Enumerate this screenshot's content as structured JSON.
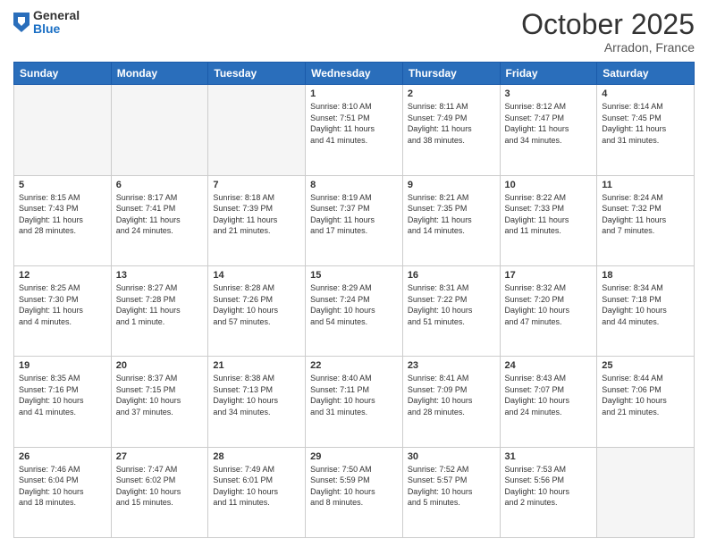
{
  "logo": {
    "general": "General",
    "blue": "Blue"
  },
  "header": {
    "month": "October 2025",
    "location": "Arradon, France"
  },
  "weekdays": [
    "Sunday",
    "Monday",
    "Tuesday",
    "Wednesday",
    "Thursday",
    "Friday",
    "Saturday"
  ],
  "weeks": [
    [
      {
        "day": "",
        "info": ""
      },
      {
        "day": "",
        "info": ""
      },
      {
        "day": "",
        "info": ""
      },
      {
        "day": "1",
        "info": "Sunrise: 8:10 AM\nSunset: 7:51 PM\nDaylight: 11 hours\nand 41 minutes."
      },
      {
        "day": "2",
        "info": "Sunrise: 8:11 AM\nSunset: 7:49 PM\nDaylight: 11 hours\nand 38 minutes."
      },
      {
        "day": "3",
        "info": "Sunrise: 8:12 AM\nSunset: 7:47 PM\nDaylight: 11 hours\nand 34 minutes."
      },
      {
        "day": "4",
        "info": "Sunrise: 8:14 AM\nSunset: 7:45 PM\nDaylight: 11 hours\nand 31 minutes."
      }
    ],
    [
      {
        "day": "5",
        "info": "Sunrise: 8:15 AM\nSunset: 7:43 PM\nDaylight: 11 hours\nand 28 minutes."
      },
      {
        "day": "6",
        "info": "Sunrise: 8:17 AM\nSunset: 7:41 PM\nDaylight: 11 hours\nand 24 minutes."
      },
      {
        "day": "7",
        "info": "Sunrise: 8:18 AM\nSunset: 7:39 PM\nDaylight: 11 hours\nand 21 minutes."
      },
      {
        "day": "8",
        "info": "Sunrise: 8:19 AM\nSunset: 7:37 PM\nDaylight: 11 hours\nand 17 minutes."
      },
      {
        "day": "9",
        "info": "Sunrise: 8:21 AM\nSunset: 7:35 PM\nDaylight: 11 hours\nand 14 minutes."
      },
      {
        "day": "10",
        "info": "Sunrise: 8:22 AM\nSunset: 7:33 PM\nDaylight: 11 hours\nand 11 minutes."
      },
      {
        "day": "11",
        "info": "Sunrise: 8:24 AM\nSunset: 7:32 PM\nDaylight: 11 hours\nand 7 minutes."
      }
    ],
    [
      {
        "day": "12",
        "info": "Sunrise: 8:25 AM\nSunset: 7:30 PM\nDaylight: 11 hours\nand 4 minutes."
      },
      {
        "day": "13",
        "info": "Sunrise: 8:27 AM\nSunset: 7:28 PM\nDaylight: 11 hours\nand 1 minute."
      },
      {
        "day": "14",
        "info": "Sunrise: 8:28 AM\nSunset: 7:26 PM\nDaylight: 10 hours\nand 57 minutes."
      },
      {
        "day": "15",
        "info": "Sunrise: 8:29 AM\nSunset: 7:24 PM\nDaylight: 10 hours\nand 54 minutes."
      },
      {
        "day": "16",
        "info": "Sunrise: 8:31 AM\nSunset: 7:22 PM\nDaylight: 10 hours\nand 51 minutes."
      },
      {
        "day": "17",
        "info": "Sunrise: 8:32 AM\nSunset: 7:20 PM\nDaylight: 10 hours\nand 47 minutes."
      },
      {
        "day": "18",
        "info": "Sunrise: 8:34 AM\nSunset: 7:18 PM\nDaylight: 10 hours\nand 44 minutes."
      }
    ],
    [
      {
        "day": "19",
        "info": "Sunrise: 8:35 AM\nSunset: 7:16 PM\nDaylight: 10 hours\nand 41 minutes."
      },
      {
        "day": "20",
        "info": "Sunrise: 8:37 AM\nSunset: 7:15 PM\nDaylight: 10 hours\nand 37 minutes."
      },
      {
        "day": "21",
        "info": "Sunrise: 8:38 AM\nSunset: 7:13 PM\nDaylight: 10 hours\nand 34 minutes."
      },
      {
        "day": "22",
        "info": "Sunrise: 8:40 AM\nSunset: 7:11 PM\nDaylight: 10 hours\nand 31 minutes."
      },
      {
        "day": "23",
        "info": "Sunrise: 8:41 AM\nSunset: 7:09 PM\nDaylight: 10 hours\nand 28 minutes."
      },
      {
        "day": "24",
        "info": "Sunrise: 8:43 AM\nSunset: 7:07 PM\nDaylight: 10 hours\nand 24 minutes."
      },
      {
        "day": "25",
        "info": "Sunrise: 8:44 AM\nSunset: 7:06 PM\nDaylight: 10 hours\nand 21 minutes."
      }
    ],
    [
      {
        "day": "26",
        "info": "Sunrise: 7:46 AM\nSunset: 6:04 PM\nDaylight: 10 hours\nand 18 minutes."
      },
      {
        "day": "27",
        "info": "Sunrise: 7:47 AM\nSunset: 6:02 PM\nDaylight: 10 hours\nand 15 minutes."
      },
      {
        "day": "28",
        "info": "Sunrise: 7:49 AM\nSunset: 6:01 PM\nDaylight: 10 hours\nand 11 minutes."
      },
      {
        "day": "29",
        "info": "Sunrise: 7:50 AM\nSunset: 5:59 PM\nDaylight: 10 hours\nand 8 minutes."
      },
      {
        "day": "30",
        "info": "Sunrise: 7:52 AM\nSunset: 5:57 PM\nDaylight: 10 hours\nand 5 minutes."
      },
      {
        "day": "31",
        "info": "Sunrise: 7:53 AM\nSunset: 5:56 PM\nDaylight: 10 hours\nand 2 minutes."
      },
      {
        "day": "",
        "info": ""
      }
    ]
  ]
}
